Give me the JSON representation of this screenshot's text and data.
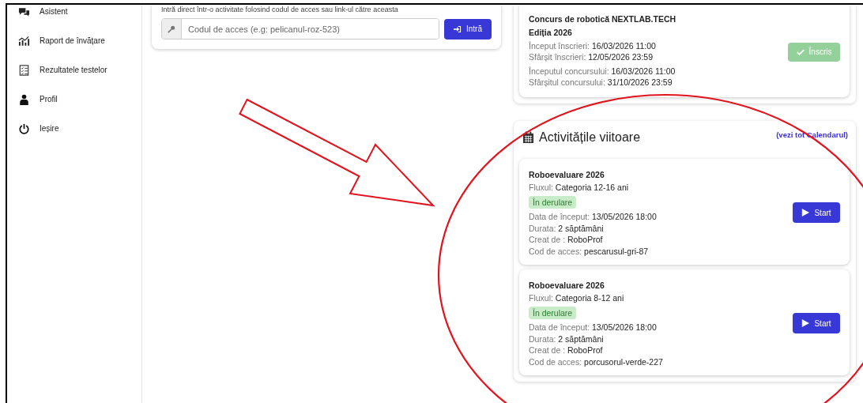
{
  "sidebar": {
    "items": [
      {
        "label": "Asistent",
        "kind": "chat"
      },
      {
        "label": "Raport de învățare",
        "kind": "chart"
      },
      {
        "label": "Rezultatele testelor",
        "kind": "checklist"
      },
      {
        "label": "Profil",
        "kind": "person"
      },
      {
        "label": "Ieșire",
        "kind": "power"
      }
    ]
  },
  "access_card": {
    "hint": "Intră direct într-o activitate folosind codul de acces sau link-ul către aceasta",
    "placeholder": "Codul de acces (e.g: pelicanul-roz-523)",
    "button": "Intră"
  },
  "contest": {
    "title": "Concurs de robotică NEXTLAB.TECH",
    "edition": "Ediția 2026",
    "groups": [
      [
        {
          "label": "Început înscrieri:",
          "value": "16/03/2026 11:00"
        },
        {
          "label": "Sfârșit înscrieri:",
          "value": "12/05/2026 23:59"
        }
      ],
      [
        {
          "label": "Începutul concursului:",
          "value": "16/03/2026 11:00"
        },
        {
          "label": "Sfârșitul concursului:",
          "value": "31/10/2026 23:59"
        }
      ]
    ],
    "button": {
      "label": "Înscris",
      "enrolled": true
    }
  },
  "upcoming": {
    "title": "Activitățile viitoare",
    "link": "(vezi tot Calendarul)",
    "activities": [
      {
        "title": "Roboevaluare 2026",
        "stream": {
          "label": "Fluxul:",
          "value": "Categoria 12-16 ani"
        },
        "status": "În derulare",
        "details": [
          {
            "label": "Data de început:",
            "value": "13/05/2026 18:00"
          },
          {
            "label": "Durata:",
            "value": "2 săptămâni"
          },
          {
            "label": "Creat de :",
            "value": "RoboProf"
          },
          {
            "label": "Cod de acces:",
            "value": "pescarusul-gri-87"
          }
        ],
        "button": "Start"
      },
      {
        "title": "Roboevaluare 2026",
        "stream": {
          "label": "Fluxul:",
          "value": "Categoria 8-12 ani"
        },
        "status": "În derulare",
        "details": [
          {
            "label": "Data de început:",
            "value": "13/05/2026 18:00"
          },
          {
            "label": "Durata:",
            "value": "2 săptămâni"
          },
          {
            "label": "Creat de :",
            "value": "RoboProf"
          },
          {
            "label": "Cod de acces:",
            "value": "porcusorul-verde-227"
          }
        ],
        "button": "Start"
      }
    ]
  }
}
